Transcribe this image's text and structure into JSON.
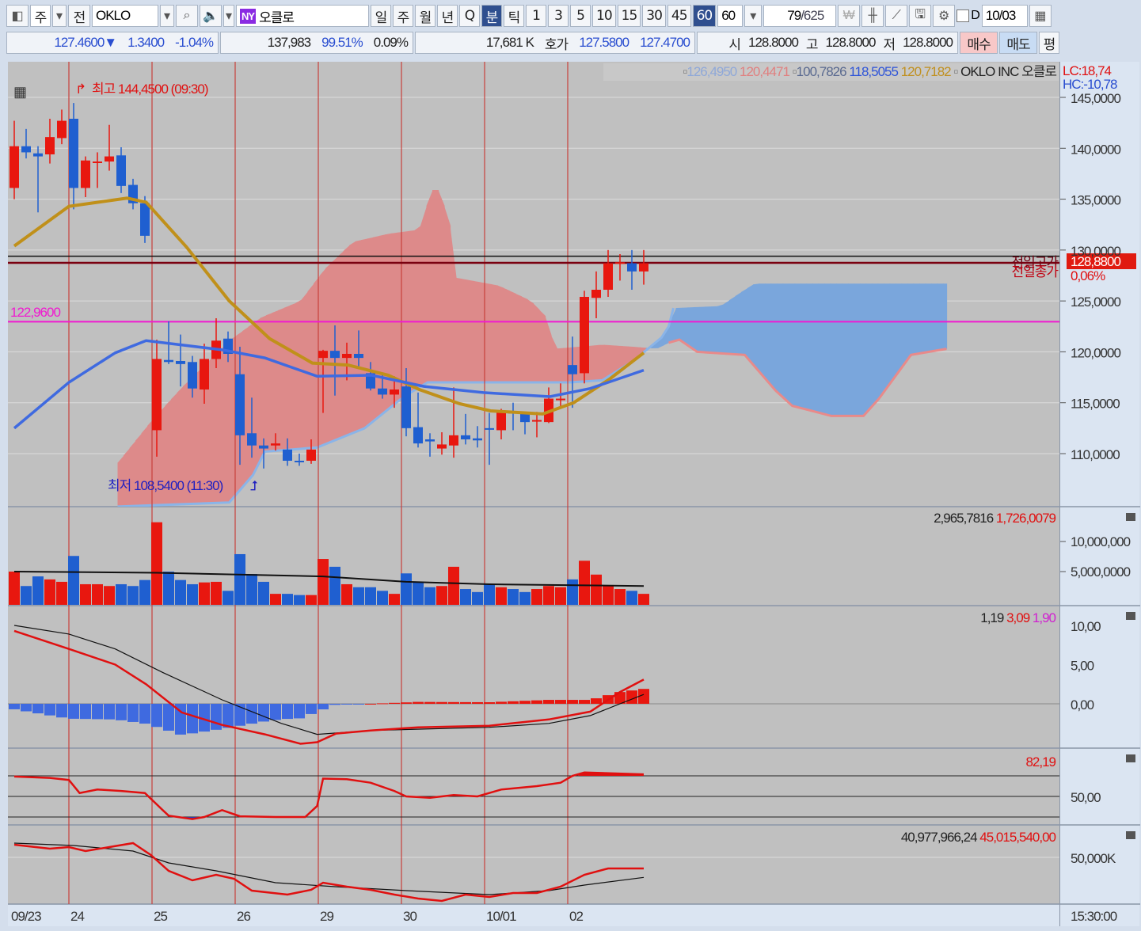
{
  "toolbar": {
    "market": "주",
    "prev": "전",
    "symbol": "OKLO",
    "exchange_badge": "NY",
    "name": "오클로",
    "periods": [
      "일",
      "주",
      "월",
      "년",
      "Q",
      "분",
      "틱"
    ],
    "active_period": "분",
    "intervals": [
      "1",
      "3",
      "5",
      "10",
      "15",
      "30",
      "45",
      "60"
    ],
    "active_interval": "60",
    "interval_value": "60",
    "count": "79",
    "total": "/625",
    "d_label": "D",
    "date": "10/03"
  },
  "quote": {
    "price": "127.4600▼",
    "change": "1.3400",
    "change_pct": "-1.04%",
    "volume": "137,983",
    "vol_ratio": "99.51%",
    "turnover": "0.09%",
    "amount": "17,681 K",
    "hoga_label": "호가",
    "ask": "127.5800",
    "bid": "127.4700",
    "open_label": "시",
    "open": "128.8000",
    "high_label": "고",
    "high": "128.8000",
    "low_label": "저",
    "low": "128.8000",
    "buy": "매수",
    "sell": "매도",
    "flat": "평"
  },
  "legend": {
    "v1": "126,4950",
    "v2": "120,4471",
    "v3": "100,7826",
    "v4": "118,5055",
    "v5": "120,7182",
    "title": "OKLO INC  오클로",
    "lc": "LC:18,74",
    "hc": "HC:-10,78"
  },
  "annotations": {
    "high": "최고 144,4500 (09:30)",
    "low": "최저 108,5400 (11:30)",
    "level": "122,9600",
    "prev_high": "전일고가",
    "prev_close": "전일종가",
    "last_price": "128,8800",
    "last_pct": "0,06%"
  },
  "axes": {
    "price": [
      "145,0000",
      "140,0000",
      "135,0000",
      "130,0000",
      "125,0000",
      "120,0000",
      "115,0000",
      "110,0000"
    ],
    "volume": [
      "10,000,000",
      "5,000,0000"
    ],
    "macd": [
      "10,00",
      "5,00",
      "0,00"
    ],
    "stoch": [
      "50,00"
    ],
    "obv": [
      "50,000K"
    ],
    "time": "15:30:00",
    "dates": [
      "09/23",
      "24",
      "25",
      "26",
      "29",
      "30",
      "10/01",
      "02"
    ]
  },
  "panels": {
    "volume": {
      "v1": "2,965,7816",
      "v2": "1,726,0079"
    },
    "macd": {
      "v1": "1,19",
      "v2": "3,09",
      "v3": "1,90"
    },
    "stoch": {
      "v1": "82,19"
    },
    "obv": {
      "v1": "40,977,966,24",
      "v2": "45,015,540,00"
    }
  },
  "colors": {
    "up": "#e8170f",
    "down": "#1f5fd0",
    "cloud_bull": "#dd8a8a",
    "cloud_bear": "#7aa6dc",
    "ma1": "#c0901a",
    "ma2": "#3f6ae0",
    "level": "#f01ad0"
  },
  "chart_data": {
    "type": "candlestick",
    "date_start_index": [
      0,
      5,
      12,
      19,
      26,
      33,
      40,
      47
    ],
    "ohlc": [
      [
        136.1,
        142.7,
        135.0,
        140.2
      ],
      [
        140.2,
        141.9,
        139.0,
        139.6
      ],
      [
        139.5,
        140.2,
        133.7,
        139.2
      ],
      [
        139.4,
        142.9,
        138.5,
        141.1
      ],
      [
        141.0,
        143.8,
        140.4,
        142.7
      ],
      [
        142.9,
        144.45,
        134.0,
        136.1
      ],
      [
        136.1,
        139.2,
        135.2,
        138.8
      ],
      [
        138.6,
        139.6,
        136.1,
        138.7
      ],
      [
        138.7,
        142.3,
        137.8,
        139.2
      ],
      [
        139.3,
        140.1,
        135.6,
        136.3
      ],
      [
        136.4,
        137.0,
        134.0,
        134.6
      ],
      [
        134.6,
        135.3,
        130.7,
        131.4
      ],
      [
        112.3,
        121.2,
        109.7,
        119.3
      ],
      [
        119.2,
        123.0,
        118.8,
        119.0
      ],
      [
        119.1,
        121.7,
        116.6,
        118.8
      ],
      [
        119.0,
        119.6,
        115.5,
        116.4
      ],
      [
        116.3,
        120.8,
        114.9,
        119.3
      ],
      [
        119.3,
        123.3,
        118.4,
        121.1
      ],
      [
        121.3,
        122.0,
        119.0,
        119.8
      ],
      [
        117.8,
        120.5,
        108.9,
        111.8
      ],
      [
        112.0,
        115.5,
        109.6,
        110.8
      ],
      [
        110.8,
        111.5,
        108.54,
        110.5
      ],
      [
        110.8,
        112.0,
        110.3,
        111.0
      ],
      [
        110.4,
        111.5,
        108.8,
        109.3
      ],
      [
        109.3,
        110.0,
        108.8,
        109.2
      ],
      [
        109.3,
        111.4,
        109.0,
        110.4
      ],
      [
        119.4,
        120.2,
        114.0,
        120.1
      ],
      [
        120.1,
        122.6,
        115.7,
        119.4
      ],
      [
        119.4,
        120.9,
        117.2,
        119.8
      ],
      [
        119.8,
        122.1,
        118.4,
        119.4
      ],
      [
        117.9,
        119.0,
        116.2,
        116.4
      ],
      [
        116.4,
        117.7,
        115.4,
        115.8
      ],
      [
        115.8,
        117.6,
        114.5,
        116.3
      ],
      [
        116.6,
        118.4,
        111.7,
        112.5
      ],
      [
        112.6,
        116.0,
        110.6,
        111.0
      ],
      [
        111.4,
        112.0,
        109.7,
        111.2
      ],
      [
        110.5,
        112.1,
        109.9,
        110.9
      ],
      [
        110.8,
        116.5,
        109.6,
        111.8
      ],
      [
        111.8,
        113.9,
        110.9,
        111.4
      ],
      [
        111.5,
        112.7,
        110.6,
        111.3
      ],
      [
        112.5,
        114.0,
        108.9,
        112.4
      ],
      [
        112.3,
        114.4,
        111.4,
        114.1
      ],
      [
        114.1,
        115.0,
        112.3,
        114.0
      ],
      [
        113.9,
        114.1,
        111.9,
        113.1
      ],
      [
        113.2,
        114.1,
        111.6,
        113.3
      ],
      [
        113.1,
        116.5,
        113.0,
        115.4
      ],
      [
        115.3,
        116.9,
        114.6,
        115.4
      ],
      [
        118.7,
        121.5,
        114.5,
        117.8
      ],
      [
        117.9,
        126.0,
        116.9,
        125.4
      ],
      [
        125.3,
        127.9,
        123.3,
        126.1
      ],
      [
        126.1,
        130.0,
        125.4,
        128.7
      ],
      [
        128.7,
        129.6,
        127.0,
        128.8
      ],
      [
        128.7,
        130.0,
        126.1,
        127.9
      ],
      [
        127.9,
        130.0,
        126.6,
        128.7
      ]
    ],
    "ylim": [
      104.8,
      148
    ],
    "ma_gold": [
      [
        0,
        130.4
      ],
      [
        4.6,
        134.3
      ],
      [
        9.5,
        135.1
      ],
      [
        11.1,
        134.7
      ],
      [
        14.5,
        130.3
      ],
      [
        18.1,
        125.0
      ],
      [
        21.5,
        121.3
      ],
      [
        25.1,
        118.9
      ],
      [
        28.1,
        118.7
      ],
      [
        31.5,
        117.7
      ],
      [
        34.1,
        116.3
      ],
      [
        37.5,
        114.9
      ],
      [
        40.1,
        114.2
      ],
      [
        44.5,
        113.9
      ],
      [
        47.1,
        115.0
      ],
      [
        50.1,
        117.3
      ],
      [
        53,
        119.9
      ]
    ],
    "ma_blue": [
      [
        0,
        112.5
      ],
      [
        4.6,
        117.0
      ],
      [
        8.5,
        119.9
      ],
      [
        11.1,
        121.1
      ],
      [
        17.5,
        120.2
      ],
      [
        21.1,
        119.4
      ],
      [
        25.5,
        117.6
      ],
      [
        30.1,
        117.7
      ],
      [
        34.5,
        116.6
      ],
      [
        39.5,
        116.0
      ],
      [
        45.1,
        115.6
      ],
      [
        48.5,
        116.4
      ],
      [
        53,
        118.2
      ]
    ],
    "span_a": [
      [
        8.7,
        109.1
      ],
      [
        11.6,
        113.3
      ],
      [
        14.1,
        116.5
      ],
      [
        18.1,
        121.1
      ],
      [
        20.8,
        123.4
      ],
      [
        24.1,
        125.0
      ],
      [
        26.1,
        128.1
      ],
      [
        28.5,
        130.8
      ],
      [
        31.5,
        131.6
      ],
      [
        34.1,
        132.0
      ],
      [
        35.1,
        135.9
      ],
      [
        35.8,
        135.9
      ],
      [
        36.8,
        132.0
      ],
      [
        37.1,
        127.3
      ],
      [
        40.8,
        126.5
      ],
      [
        43.5,
        125.0
      ],
      [
        44.8,
        123.4
      ],
      [
        45.5,
        120.3
      ],
      [
        49.5,
        120.7
      ],
      [
        52.1,
        120.5
      ],
      [
        54.1,
        120.3
      ],
      [
        55.1,
        120.9
      ],
      [
        56,
        121.2
      ],
      [
        57.5,
        120.0
      ],
      [
        61.5,
        119.7
      ],
      [
        64.1,
        116.2
      ],
      [
        65.5,
        114.7
      ],
      [
        68.8,
        113.7
      ],
      [
        71.5,
        113.7
      ],
      [
        72.8,
        115.4
      ],
      [
        75.5,
        119.7
      ],
      [
        78.5,
        120.3
      ]
    ],
    "span_b": [
      [
        8.7,
        104.8
      ],
      [
        18.1,
        105.2
      ],
      [
        20.1,
        107.9
      ],
      [
        21.1,
        110.2
      ],
      [
        25.5,
        110.6
      ],
      [
        29.5,
        112.5
      ],
      [
        32.8,
        115.6
      ],
      [
        34.8,
        117.0
      ],
      [
        46.8,
        117.0
      ],
      [
        49.5,
        117.2
      ],
      [
        52.1,
        119.1
      ],
      [
        54.5,
        121.4
      ],
      [
        55.1,
        122.5
      ],
      [
        55.5,
        124.3
      ],
      [
        59.5,
        124.5
      ],
      [
        60.1,
        125.0
      ],
      [
        61.1,
        125.8
      ],
      [
        62.3,
        126.7
      ],
      [
        78.5,
        126.7
      ]
    ],
    "ref_lines": {
      "prev_high": 129.4,
      "prev_close": 128.74,
      "level": 122.96
    },
    "volume_millions": [
      5.0,
      2.6,
      4.2,
      3.7,
      3.3,
      7.6,
      2.9,
      2.9,
      2.6,
      2.9,
      2.6,
      3.6,
      13.2,
      5.0,
      3.6,
      2.9,
      3.2,
      3.3,
      1.8,
      7.9,
      4.6,
      3.3,
      1.3,
      1.3,
      1.1,
      1.1,
      7.1,
      5.8,
      2.9,
      2.4,
      2.4,
      1.8,
      1.3,
      4.7,
      3.3,
      2.4,
      2.6,
      5.8,
      2.1,
      1.6,
      2.9,
      2.4,
      2.1,
      1.6,
      2.1,
      2.6,
      2.4,
      3.7,
      6.8,
      4.5,
      2.6,
      2.1,
      1.8,
      1.3
    ],
    "volume_ma": [
      [
        0,
        5.0
      ],
      [
        12,
        4.8
      ],
      [
        26,
        4.2
      ],
      [
        33,
        3.3
      ],
      [
        40,
        2.9
      ],
      [
        53,
        2.6
      ]
    ],
    "macd": [
      [
        0,
        9.3
      ],
      [
        4.6,
        7.0
      ],
      [
        8.5,
        5.0
      ],
      [
        11.1,
        2.5
      ],
      [
        14.1,
        -1.1
      ],
      [
        17.5,
        -2.7
      ],
      [
        21.1,
        -3.9
      ],
      [
        24.1,
        -5.1
      ],
      [
        25.5,
        -4.9
      ],
      [
        27.1,
        -3.8
      ],
      [
        30,
        -3.4
      ],
      [
        34,
        -3.0
      ],
      [
        40,
        -2.8
      ],
      [
        45,
        -2.0
      ],
      [
        48.5,
        -1.0
      ],
      [
        51,
        1.5
      ],
      [
        53,
        3.09
      ]
    ],
    "macd_signal": [
      [
        0,
        10.0
      ],
      [
        4.6,
        8.9
      ],
      [
        8.5,
        7.0
      ],
      [
        12.5,
        4.0
      ],
      [
        17.5,
        0.5
      ],
      [
        22.5,
        -2.5
      ],
      [
        25.5,
        -3.9
      ],
      [
        30,
        -3.4
      ],
      [
        40,
        -3.0
      ],
      [
        45,
        -2.5
      ],
      [
        48.5,
        -1.5
      ],
      [
        51,
        0.0
      ],
      [
        53,
        1.19
      ]
    ],
    "stoch": [
      [
        0,
        79
      ],
      [
        3,
        77
      ],
      [
        4.6,
        74
      ],
      [
        5.5,
        55
      ],
      [
        7,
        60
      ],
      [
        9,
        58
      ],
      [
        11,
        55
      ],
      [
        12.5,
        30
      ],
      [
        13,
        22
      ],
      [
        15,
        17
      ],
      [
        16,
        20
      ],
      [
        17.5,
        30
      ],
      [
        19,
        21
      ],
      [
        22,
        20
      ],
      [
        24.5,
        20
      ],
      [
        25.5,
        36
      ],
      [
        26,
        76
      ],
      [
        28,
        75
      ],
      [
        30,
        70
      ],
      [
        32,
        58
      ],
      [
        33,
        50
      ],
      [
        35,
        48
      ],
      [
        37,
        52
      ],
      [
        39,
        50
      ],
      [
        41,
        60
      ],
      [
        44,
        65
      ],
      [
        46,
        70
      ],
      [
        47,
        80
      ],
      [
        48,
        85
      ],
      [
        53,
        82.19
      ]
    ],
    "stoch_levels": [
      80,
      50,
      20
    ],
    "obv_k": [
      [
        0,
        55714
      ],
      [
        3,
        53929
      ],
      [
        4.6,
        54643
      ],
      [
        6,
        52857
      ],
      [
        8,
        54643
      ],
      [
        10,
        56429
      ],
      [
        11.5,
        51071
      ],
      [
        13,
        43929
      ],
      [
        15,
        39643
      ],
      [
        17,
        42143
      ],
      [
        18.5,
        40357
      ],
      [
        20,
        35000
      ],
      [
        23,
        33214
      ],
      [
        25,
        35357
      ],
      [
        26,
        38571
      ],
      [
        28,
        36786
      ],
      [
        30,
        35357
      ],
      [
        32,
        33214
      ],
      [
        34,
        31429
      ],
      [
        36,
        30357
      ],
      [
        38,
        33214
      ],
      [
        40,
        32143
      ],
      [
        42,
        33929
      ],
      [
        44,
        33929
      ],
      [
        46,
        36786
      ],
      [
        48,
        42143
      ],
      [
        50,
        45000
      ],
      [
        53,
        45016
      ]
    ],
    "obv_signal_k": [
      [
        0,
        56429
      ],
      [
        5,
        55357
      ],
      [
        10,
        52857
      ],
      [
        13,
        47500
      ],
      [
        17,
        43929
      ],
      [
        22,
        38571
      ],
      [
        27,
        36786
      ],
      [
        33,
        35000
      ],
      [
        40,
        33214
      ],
      [
        45,
        35000
      ],
      [
        48,
        37500
      ],
      [
        53,
        40978
      ]
    ]
  }
}
